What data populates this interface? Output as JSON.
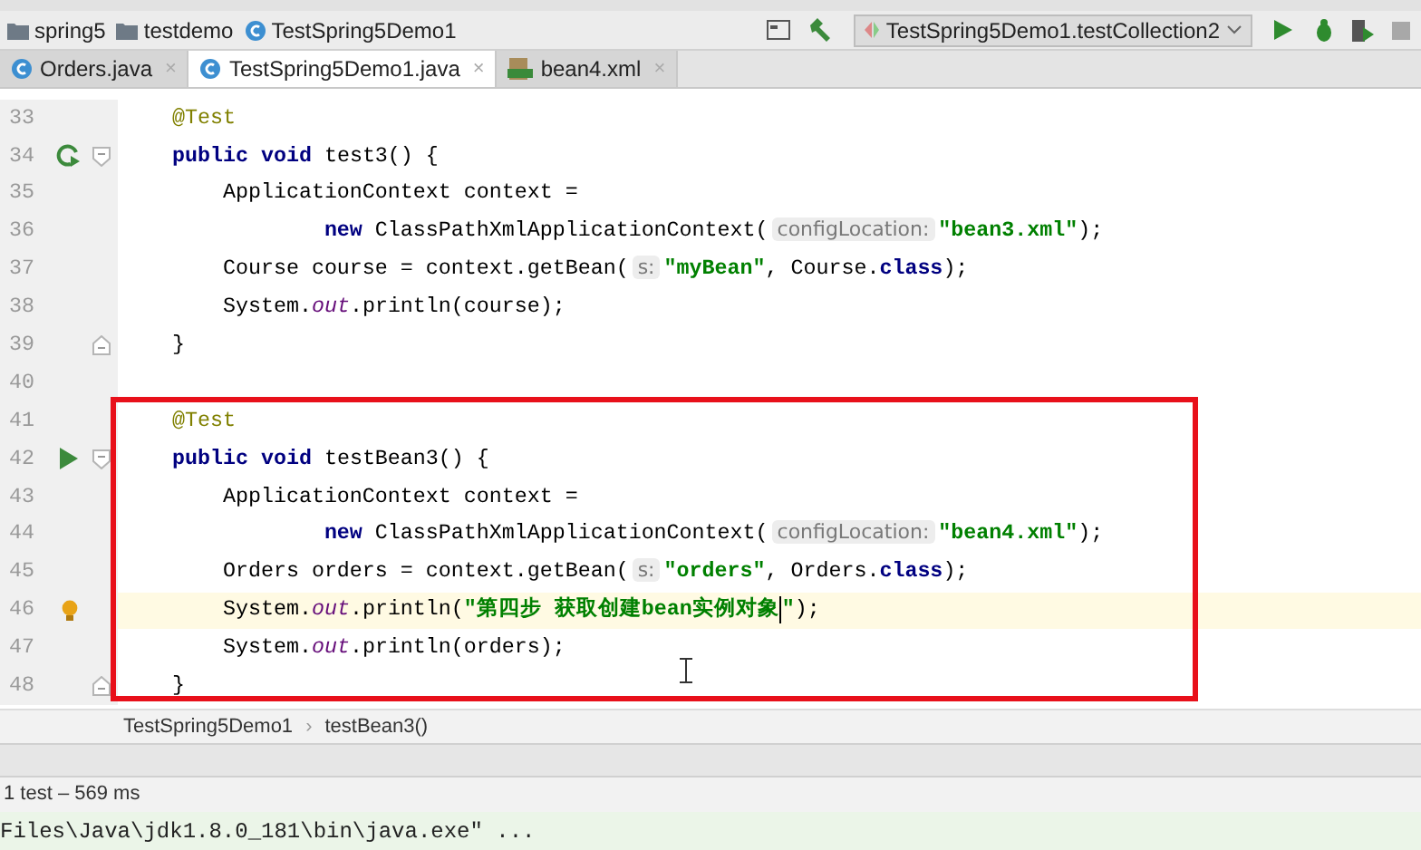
{
  "breadcrumbs": [
    {
      "label": "spring5",
      "kind": "folder"
    },
    {
      "label": "testdemo",
      "kind": "folder"
    },
    {
      "label": "TestSpring5Demo1",
      "kind": "class"
    }
  ],
  "run_config": {
    "label": "TestSpring5Demo1.testCollection2"
  },
  "tabs": [
    {
      "label": "Orders.java",
      "kind": "class",
      "selected": false,
      "close": "×"
    },
    {
      "label": "TestSpring5Demo1.java",
      "kind": "class",
      "selected": true,
      "close": "×"
    },
    {
      "label": "bean4.xml",
      "kind": "xml",
      "selected": false,
      "close": "×"
    }
  ],
  "editor": {
    "lines": [
      {
        "number": "33",
        "kind": "plain",
        "fold_start": false,
        "fold_end": false,
        "current": false,
        "tokens": [
          {
            "kind": "ann",
            "text": "@Test"
          }
        ]
      },
      {
        "number": "34",
        "kind": "rerun",
        "fold_start": true,
        "fold_end": false,
        "current": false,
        "tokens": [
          {
            "kind": "kw",
            "text": "public void "
          },
          {
            "kind": "plain",
            "text": "test3() {"
          }
        ]
      },
      {
        "number": "35",
        "kind": "plain",
        "fold_start": false,
        "fold_end": false,
        "current": false,
        "tokens": [
          {
            "kind": "plain",
            "text": "    ApplicationContext context ="
          }
        ]
      },
      {
        "number": "36",
        "kind": "plain",
        "fold_start": false,
        "fold_end": false,
        "current": false,
        "tokens": [
          {
            "kind": "kw",
            "text": "            new "
          },
          {
            "kind": "plain",
            "text": "ClassPathXmlApplicationContext("
          },
          {
            "kind": "hint",
            "text": "configLocation:"
          },
          {
            "kind": "str",
            "text": "\"bean3.xml\""
          },
          {
            "kind": "plain",
            "text": ");"
          }
        ]
      },
      {
        "number": "37",
        "kind": "plain",
        "fold_start": false,
        "fold_end": false,
        "current": false,
        "tokens": [
          {
            "kind": "plain",
            "text": "    Course course = context.getBean("
          },
          {
            "kind": "hint",
            "text": "s:"
          },
          {
            "kind": "str",
            "text": "\"myBean\""
          },
          {
            "kind": "plain",
            "text": ", Course."
          },
          {
            "kind": "kw",
            "text": "class"
          },
          {
            "kind": "plain",
            "text": ");"
          }
        ]
      },
      {
        "number": "38",
        "kind": "plain",
        "fold_start": false,
        "fold_end": false,
        "current": false,
        "tokens": [
          {
            "kind": "plain",
            "text": "    System."
          },
          {
            "kind": "field",
            "text": "out"
          },
          {
            "kind": "plain",
            "text": ".println(course);"
          }
        ]
      },
      {
        "number": "39",
        "kind": "plain",
        "fold_start": false,
        "fold_end": true,
        "current": false,
        "tokens": [
          {
            "kind": "plain",
            "text": "}"
          }
        ]
      },
      {
        "number": "40",
        "kind": "plain",
        "fold_start": false,
        "fold_end": false,
        "current": false
      },
      {
        "number": "41",
        "kind": "plain",
        "fold_start": false,
        "fold_end": false,
        "current": false,
        "tokens": [
          {
            "kind": "ann",
            "text": "@Test"
          }
        ]
      },
      {
        "number": "42",
        "kind": "run",
        "fold_start": true,
        "fold_end": false,
        "current": false,
        "tokens": [
          {
            "kind": "kw",
            "text": "public void "
          },
          {
            "kind": "plain",
            "text": "testBean3() {"
          }
        ]
      },
      {
        "number": "43",
        "kind": "plain",
        "fold_start": false,
        "fold_end": false,
        "current": false,
        "tokens": [
          {
            "kind": "plain",
            "text": "    ApplicationContext context ="
          }
        ]
      },
      {
        "number": "44",
        "kind": "plain",
        "fold_start": false,
        "fold_end": false,
        "current": false,
        "tokens": [
          {
            "kind": "kw",
            "text": "            new "
          },
          {
            "kind": "plain",
            "text": "ClassPathXmlApplicationContext("
          },
          {
            "kind": "hint",
            "text": "configLocation:"
          },
          {
            "kind": "str",
            "text": "\"bean4.xml\""
          },
          {
            "kind": "plain",
            "text": ");"
          }
        ]
      },
      {
        "number": "45",
        "kind": "plain",
        "fold_start": false,
        "fold_end": false,
        "current": false,
        "tokens": [
          {
            "kind": "plain",
            "text": "    Orders orders = context.getBean("
          },
          {
            "kind": "hint",
            "text": "s:"
          },
          {
            "kind": "str",
            "text": "\"orders\""
          },
          {
            "kind": "plain",
            "text": ", Orders."
          },
          {
            "kind": "kw",
            "text": "class"
          },
          {
            "kind": "plain",
            "text": ");"
          }
        ]
      },
      {
        "number": "46",
        "kind": "bulb",
        "fold_start": false,
        "fold_end": false,
        "current": true,
        "tokens": [
          {
            "kind": "plain",
            "text": "    System."
          },
          {
            "kind": "field",
            "text": "out"
          },
          {
            "kind": "plain",
            "text": ".println("
          },
          {
            "kind": "str",
            "text": "\"第四步 获取创建bean实例对象"
          },
          {
            "kind": "caret"
          },
          {
            "kind": "str",
            "text": "\""
          },
          {
            "kind": "plain",
            "text": ");"
          }
        ]
      },
      {
        "number": "47",
        "kind": "plain",
        "fold_start": false,
        "fold_end": false,
        "current": false,
        "tokens": [
          {
            "kind": "plain",
            "text": "    System."
          },
          {
            "kind": "field",
            "text": "out"
          },
          {
            "kind": "plain",
            "text": ".println(orders);"
          }
        ]
      },
      {
        "number": "48",
        "kind": "plain",
        "fold_start": false,
        "fold_end": true,
        "current": false,
        "tokens": [
          {
            "kind": "plain",
            "text": "}"
          }
        ]
      }
    ]
  },
  "footer_breadcrumbs": [
    "TestSpring5Demo1",
    "testBean3()"
  ],
  "footer_separator": "›",
  "test_status": "1 test – 569 ms",
  "console_line": "Files\\Java\\jdk1.8.0_181\\bin\\java.exe\" ..."
}
